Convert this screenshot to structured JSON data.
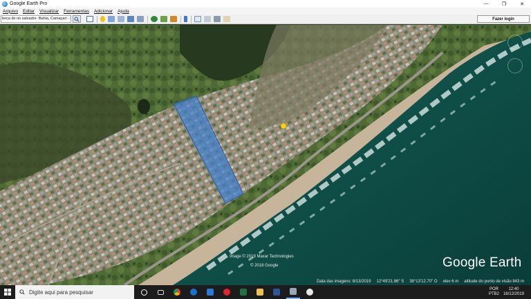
{
  "window": {
    "title": "Google Earth Pro",
    "minimize_glyph": "—",
    "maximize_glyph": "❐",
    "close_glyph": "✕"
  },
  "menu": {
    "items": [
      "Arquivo",
      "Editar",
      "Visualizar",
      "Ferramentas",
      "Adicionar",
      "Ajuda"
    ]
  },
  "toolbar": {
    "search_value": "boca do rio salvador- Bahia, Camaçari - BA",
    "login_label": "Fazer login"
  },
  "map": {
    "copyright_1": "Image © 2019 Maxar Technologies",
    "copyright_2": "© 2018 Google",
    "logo_text": "Google Earth",
    "polygon_color": "#3f7fd0"
  },
  "status": {
    "imagery_date": "Data das imagens: 8/13/2019",
    "latitude": "12°49'21.86\" S",
    "longitude": "38°13'12.70\" O",
    "elevation": "elev   6 m",
    "eye_altitude": "altitude do ponto de visão   843 m"
  },
  "taskbar": {
    "search_placeholder": "Digite aqui para pesquisar",
    "lang_1": "POR",
    "lang_2": "PTB2",
    "time": "12:40",
    "date": "16/12/2019"
  }
}
